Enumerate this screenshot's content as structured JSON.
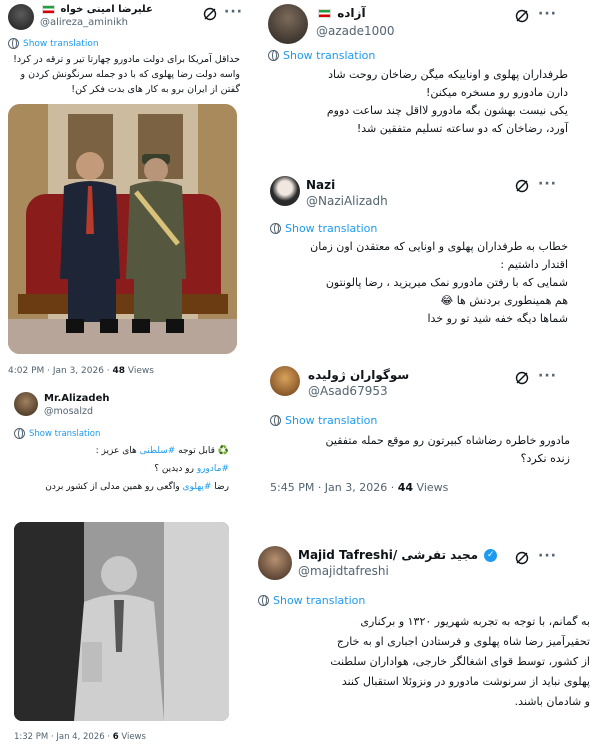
{
  "ui": {
    "show_translation": "Show translation",
    "more": "···"
  },
  "tweets": {
    "t1": {
      "name": "علیرضا امینی خواه",
      "handle": "@alireza_aminikh",
      "lines": [
        "حداقل آمریکا برای دولت مادورو چهارتا تیر و ترقه در کرد!",
        "واسه دولت رضا پهلوی که با دو جمله سرنگونش کردن و",
        "گفتن  از ایران برو  به کار های بدت فکر کن!"
      ],
      "time": "4:02 PM · Jan 3, 2026 · ",
      "views_count": "48",
      "views_label": " Views"
    },
    "t2": {
      "name": "آزاده",
      "handle": "@azade1000",
      "lines": [
        "طرفداران پهلوی و اوناییکه میگن رضاخان روحت شاد",
        "دارن مادورو رو مسخره میکنن!",
        "یکی نیست بهشون بگه مادورو لااقل چند ساعت دووم",
        "آورد، رضاخان که دو ساعته تسلیم متفقین شد!"
      ]
    },
    "t3": {
      "name": "Nazi",
      "handle": "@NaziAlizadh",
      "lines": [
        "خطاب به طرفداران پهلوی و اونایی که معتقدن اون زمان",
        "اقتدار داشتیم :",
        "شمایی که با رفتن مادورو نمک میریزید ، رضا پالونتون",
        "هم همینطوری بردنش ها 😂",
        "شماها دیگه خفه شید تو رو خدا"
      ]
    },
    "t4": {
      "name": "Mr.Alizadeh",
      "handle": "@mosalzd",
      "line1_prefix": "♻️ قابل توجه ",
      "line1_hash": "#سلطنی",
      "line1_suffix": " های عزیز :",
      "line2_hash": "#مادورو",
      "line2_suffix": " رو دیدین ؟",
      "line3_prefix": "رضا ",
      "line3_hash": "#پهلوی",
      "line3_suffix": " واگعی رو همین مدلی از کشور بردن",
      "time": "1:32 PM · Jan 4, 2026 · ",
      "views_count": "6",
      "views_label": " Views"
    },
    "t5": {
      "name": "سوگواران ژولیده",
      "handle": "@Asad67953",
      "lines": [
        "مادورو خاطره رضاشاه کبیرتون رو موقع حمله متفقین",
        "زنده نکرد؟"
      ],
      "time": "5:45 PM · Jan 3, 2026 · ",
      "views_count": "44",
      "views_label": " Views"
    },
    "t6": {
      "name": "Majid Tafreshi/ مجید تفرشی",
      "handle": "@majidtafreshi",
      "lines": [
        "به گمانم، با توجه به تجربه شهریور ۱۳۲۰ و برکناری",
        "تحقیرآمیز رضا شاه پهلوی و فرستادن اجباری او به خارج",
        "از کشور، توسط قوای اشغالگر خارجی، هواداران سلطنت",
        "پهلوی نباید از سرنوشت مادورو در ونزوئلا استقبال کنند",
        "و شادمان باشند."
      ]
    }
  }
}
